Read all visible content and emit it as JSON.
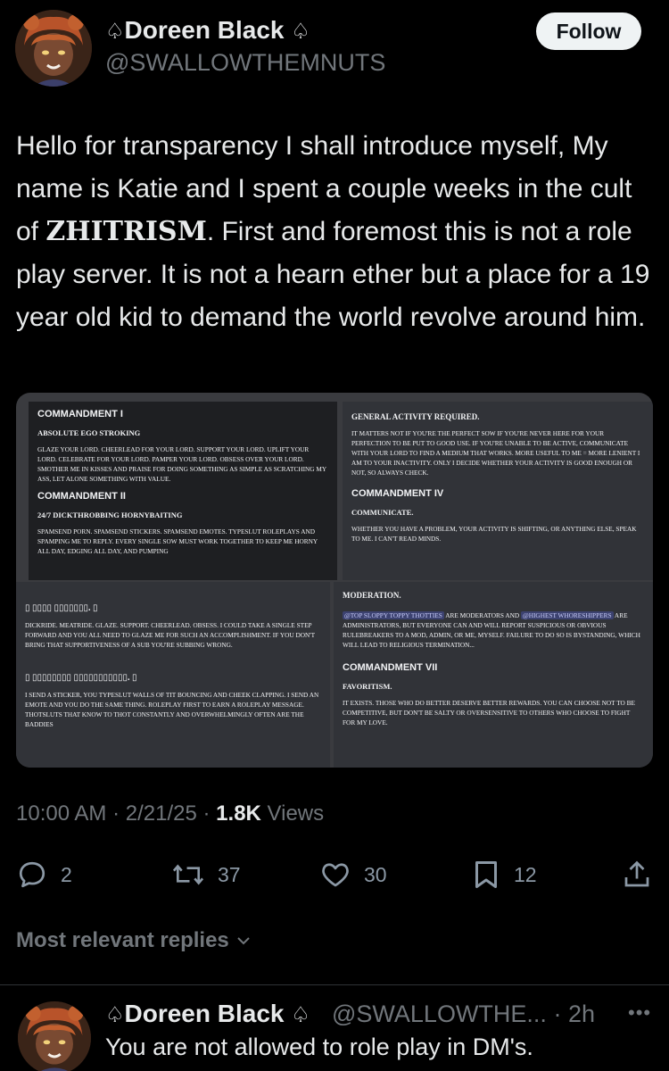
{
  "tweet": {
    "author_name": "Doreen Black",
    "author_spade": "♤",
    "author_handle": "@SWALLOWTHEMNUTS",
    "follow_label": "Follow",
    "text_part1": "Hello for transparency I shall introduce myself, My name is Katie and I spent a couple weeks in the cult of ",
    "text_emphasis": "ZHITRISM",
    "text_part2": ". First and foremost this is not a role play server. It is not a hearn ether but a place for a 19 year old kid to demand the world revolve around him.",
    "time": "10:00 AM",
    "date": "2/21/25",
    "views_count": "1.8K",
    "views_label": "Views",
    "sep": "·"
  },
  "media": {
    "p1": {
      "heading": "COMMANDMENT I",
      "sub1": "ABSOLUTE EGO STROKING",
      "body1": "Glaze your lord. Cheerlead for your lord. Support your lord. Uplift your lord. Celebrate for your lord. Pamper your lord. Obsess over your lord. Smother me in kisses and praise for doing something as simple as scratching my ass, let alone something with value.",
      "heading2": "COMMANDMENT II",
      "sub2": "24/7 DICKTHROBBING HORNYBAITING",
      "body2": "Spamsend porn. Spamsend stickers. Spamsend emotes. Typeslut roleplays and spamping me to reply. Every single sow must work together to keep me horny all day, edging all day, and pumping"
    },
    "p2": {
      "heading": "GENERAL ACTIVITY REQUIRED.",
      "body1": "It matters not if you're the perfect sow if you're never here for your perfection to be put to good use. If you're unable to be active, communicate with your lord to find a medium that works. More useful to me = more lenient I am to your inactivity. Only I decide whether your activity is good enough or not, so always check.",
      "heading2": "COMMANDMENT IV",
      "sub2": "COMMUNICATE.",
      "body2": "Whether you have a problem, your activity is shifting, or anything else, speak to me. I can't read minds."
    },
    "p3": {
      "heading": "▯ ▯▯▯▯ ▯▯▯▯▯▯▯. ▯",
      "body1": "Dickride. Meatride. Glaze. Support. Cheerlead. Obsess. I could take a single step forward and you all need to glaze me for such an accomplishment. If you don't bring that supportiveness of a sub you're subbing wrong.",
      "heading2": "▯ ▯▯▯▯▯▯▯▯ ▯▯▯▯▯▯▯▯▯▯▯. ▯",
      "body2": "I send a sticker, you typeslut walls of tit bouncing and cheek clapping. I send an emote and you do the same thing. Roleplay first to earn a roleplay message. Thotsluts that know to thot constantly and overwhelmingly often are the baddies"
    },
    "p4": {
      "heading": "MODERATION.",
      "mention1": "@Top Sloppy Toppy Thotties",
      "body1a": " are moderators and ",
      "mention2": "@Highest Whoreshippers",
      "body1b": " are administrators, but everyone can and will report suspicious or obvious rulebreakers to a mod, admin, or me, myself. Failure to do so is bystanding, which will lead to religious termination...",
      "heading2": "COMMANDMENT VII",
      "sub2": "FAVORITISM.",
      "body2": "It exists. Those who do better deserve better rewards. You can choose not to be competitive, but don't be salty or oversensitive to others who choose to fight for my love."
    }
  },
  "actions": {
    "replies": "2",
    "reposts": "37",
    "likes": "30",
    "bookmarks": "12"
  },
  "replies_filter": "Most relevant replies",
  "reply": {
    "author_name": "Doreen Black",
    "author_spade": "♤",
    "author_handle": "@SWALLOWTHE...",
    "sep": "·",
    "time": "2h",
    "more": "•••",
    "text": "You are not allowed to role play in DM's."
  },
  "colors": {
    "background": "#000000",
    "text": "#e7e9ea",
    "muted": "#71767b",
    "follow_bg": "#eff3f4"
  },
  "icons": [
    "spade-icon",
    "reply-icon",
    "repost-icon",
    "like-icon",
    "bookmark-icon",
    "share-icon",
    "chevron-down-icon",
    "more-icon"
  ]
}
